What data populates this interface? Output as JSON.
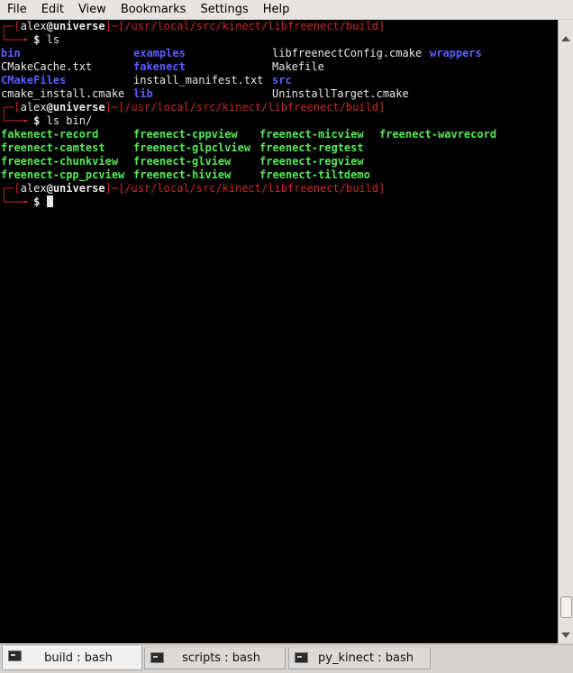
{
  "menu": [
    "File",
    "Edit",
    "View",
    "Bookmarks",
    "Settings",
    "Help"
  ],
  "terminal": {
    "prompt": {
      "user": "alex",
      "at": "@",
      "host": "universe",
      "path": "/usr/local/src/kinect/libfreenect/build",
      "symbol": "$"
    },
    "commands": [
      "ls",
      "ls bin/"
    ],
    "ls_output": [
      [
        "bin",
        "examples",
        "libfreenectConfig.cmake",
        "wrappers"
      ],
      [
        "CMakeCache.txt",
        "fakenect",
        "Makefile",
        ""
      ],
      [
        "CMakeFiles",
        "install_manifest.txt",
        "src",
        ""
      ],
      [
        "cmake_install.cmake",
        "lib",
        "UninstallTarget.cmake",
        ""
      ]
    ],
    "ls_bin_output": [
      [
        "fakenect-record",
        "freenect-cppview",
        "freenect-micview",
        "freenect-wavrecord"
      ],
      [
        "freenect-camtest",
        "freenect-glpclview",
        "freenect-regtest",
        ""
      ],
      [
        "freenect-chunkview",
        "freenect-glview",
        "freenect-regview",
        ""
      ],
      [
        "freenect-cpp_pcview",
        "freenect-hiview",
        "freenect-tiltdemo",
        ""
      ]
    ]
  },
  "tabs": [
    {
      "label": "build : bash",
      "active": true
    },
    {
      "label": "scripts : bash",
      "active": false
    },
    {
      "label": "py_kinect : bash",
      "active": false
    }
  ],
  "colors": {
    "background": "#000000",
    "prompt_frame": "#c82828",
    "directory": "#5c5cff",
    "executable": "#55e855",
    "text": "#e8e8e8"
  }
}
